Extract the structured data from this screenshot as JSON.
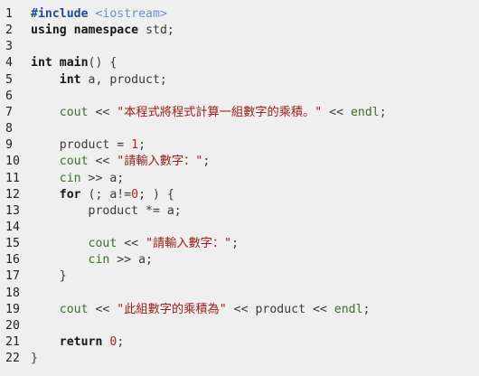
{
  "colors": {
    "background": "#efefef",
    "line_number": "#222222",
    "plain": "#3a3a3a",
    "keyword": "#151515",
    "preprocessor": "#1f4b8e",
    "include_target": "#6e8fc8",
    "library_identifier": "#3d6f2d",
    "string": "#9b1b1b",
    "number": "#b22222"
  },
  "lines": [
    {
      "n": "1",
      "tokens": [
        {
          "t": "#include",
          "k": "pre"
        },
        {
          "t": " ",
          "k": "plain"
        },
        {
          "t": "<iostream>",
          "k": "inc"
        }
      ]
    },
    {
      "n": "2",
      "tokens": [
        {
          "t": "using",
          "k": "kw"
        },
        {
          "t": " ",
          "k": "plain"
        },
        {
          "t": "namespace",
          "k": "kw"
        },
        {
          "t": " std;",
          "k": "plain"
        }
      ]
    },
    {
      "n": "3",
      "tokens": []
    },
    {
      "n": "4",
      "tokens": [
        {
          "t": "int",
          "k": "kw"
        },
        {
          "t": " ",
          "k": "plain"
        },
        {
          "t": "main",
          "k": "kw"
        },
        {
          "t": "() {",
          "k": "plain"
        }
      ]
    },
    {
      "n": "5",
      "tokens": [
        {
          "t": "    ",
          "k": "plain"
        },
        {
          "t": "int",
          "k": "kw"
        },
        {
          "t": " a, product;",
          "k": "plain"
        }
      ]
    },
    {
      "n": "6",
      "tokens": []
    },
    {
      "n": "7",
      "tokens": [
        {
          "t": "    ",
          "k": "plain"
        },
        {
          "t": "cout",
          "k": "lib"
        },
        {
          "t": " << ",
          "k": "plain"
        },
        {
          "t": "\"本程式將程式計算一組數字的乘積。\"",
          "k": "str"
        },
        {
          "t": " << ",
          "k": "plain"
        },
        {
          "t": "endl",
          "k": "lib"
        },
        {
          "t": ";",
          "k": "plain"
        }
      ]
    },
    {
      "n": "8",
      "tokens": []
    },
    {
      "n": "9",
      "tokens": [
        {
          "t": "    product = ",
          "k": "plain"
        },
        {
          "t": "1",
          "k": "num"
        },
        {
          "t": ";",
          "k": "plain"
        }
      ]
    },
    {
      "n": "10",
      "tokens": [
        {
          "t": "    ",
          "k": "plain"
        },
        {
          "t": "cout",
          "k": "lib"
        },
        {
          "t": " << ",
          "k": "plain"
        },
        {
          "t": "\"請輸入數字：\"",
          "k": "str"
        },
        {
          "t": ";",
          "k": "plain"
        }
      ]
    },
    {
      "n": "11",
      "tokens": [
        {
          "t": "    ",
          "k": "plain"
        },
        {
          "t": "cin",
          "k": "lib"
        },
        {
          "t": " >> a;",
          "k": "plain"
        }
      ]
    },
    {
      "n": "12",
      "tokens": [
        {
          "t": "    ",
          "k": "plain"
        },
        {
          "t": "for",
          "k": "kw"
        },
        {
          "t": " (; a!=",
          "k": "plain"
        },
        {
          "t": "0",
          "k": "num"
        },
        {
          "t": "; ) {",
          "k": "plain"
        }
      ]
    },
    {
      "n": "13",
      "tokens": [
        {
          "t": "        product *= a;",
          "k": "plain"
        }
      ]
    },
    {
      "n": "14",
      "tokens": []
    },
    {
      "n": "15",
      "tokens": [
        {
          "t": "        ",
          "k": "plain"
        },
        {
          "t": "cout",
          "k": "lib"
        },
        {
          "t": " << ",
          "k": "plain"
        },
        {
          "t": "\"請輸入數字：\"",
          "k": "str"
        },
        {
          "t": ";",
          "k": "plain"
        }
      ]
    },
    {
      "n": "16",
      "tokens": [
        {
          "t": "        ",
          "k": "plain"
        },
        {
          "t": "cin",
          "k": "lib"
        },
        {
          "t": " >> a;",
          "k": "plain"
        }
      ]
    },
    {
      "n": "17",
      "tokens": [
        {
          "t": "    }",
          "k": "plain"
        }
      ]
    },
    {
      "n": "18",
      "tokens": []
    },
    {
      "n": "19",
      "tokens": [
        {
          "t": "    ",
          "k": "plain"
        },
        {
          "t": "cout",
          "k": "lib"
        },
        {
          "t": " << ",
          "k": "plain"
        },
        {
          "t": "\"此組數字的乘積為\"",
          "k": "str"
        },
        {
          "t": " << product << ",
          "k": "plain"
        },
        {
          "t": "endl",
          "k": "lib"
        },
        {
          "t": ";",
          "k": "plain"
        }
      ]
    },
    {
      "n": "20",
      "tokens": []
    },
    {
      "n": "21",
      "tokens": [
        {
          "t": "    ",
          "k": "plain"
        },
        {
          "t": "return",
          "k": "kw"
        },
        {
          "t": " ",
          "k": "plain"
        },
        {
          "t": "0",
          "k": "num"
        },
        {
          "t": ";",
          "k": "plain"
        }
      ]
    },
    {
      "n": "22",
      "tokens": [
        {
          "t": "}",
          "k": "plain"
        }
      ]
    }
  ]
}
